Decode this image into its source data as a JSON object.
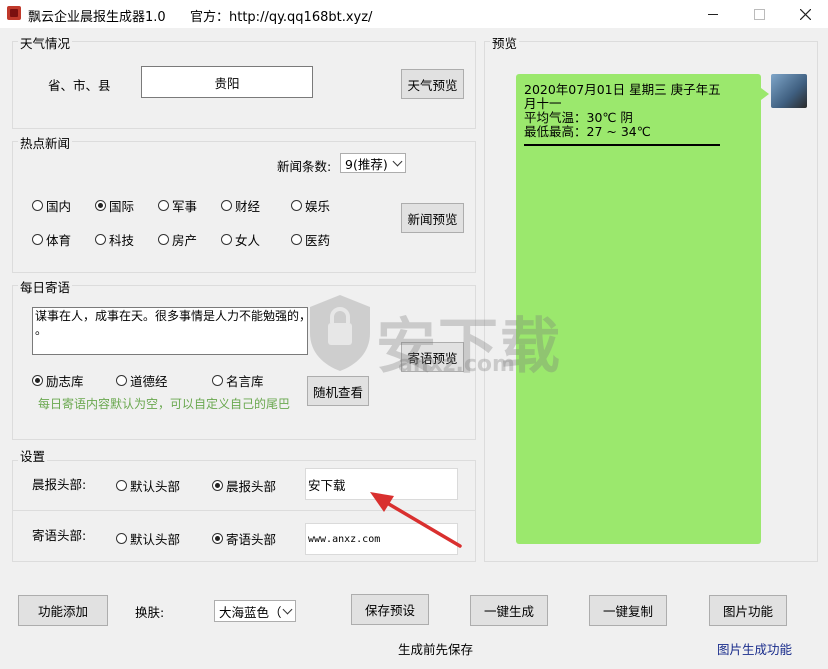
{
  "window": {
    "title": "飘云企业晨报生成器1.0",
    "site": "官方：http://qy.qq168bt.xyz/"
  },
  "weather": {
    "group_label": "天气情况",
    "location_label": "省、市、县",
    "location_value": "贵阳",
    "preview_button": "天气预览"
  },
  "news": {
    "group_label": "热点新闻",
    "count_label": "新闻条数:",
    "count_value": "9(推荐)",
    "preview_button": "新闻预览",
    "categories": [
      {
        "label": "国内",
        "selected": false
      },
      {
        "label": "国际",
        "selected": true
      },
      {
        "label": "军事",
        "selected": false
      },
      {
        "label": "财经",
        "selected": false
      },
      {
        "label": "娱乐",
        "selected": false
      },
      {
        "label": "体育",
        "selected": false
      },
      {
        "label": "科技",
        "selected": false
      },
      {
        "label": "房产",
        "selected": false
      },
      {
        "label": "女人",
        "selected": false
      },
      {
        "label": "医药",
        "selected": false
      }
    ]
  },
  "daily": {
    "group_label": "每日寄语",
    "text_line1": "谋事在人，成事在天。很多事情是人力不能勉强的，随缘就好",
    "text_line2": "。",
    "preview_button": "寄语预览",
    "random_button": "随机查看",
    "sources": [
      {
        "label": "励志库",
        "selected": true
      },
      {
        "label": "道德经",
        "selected": false
      },
      {
        "label": "名言库",
        "selected": false
      }
    ],
    "hint": "每日寄语内容默认为空，可以自定义自己的尾巴",
    "hint_color": "#6aa84f"
  },
  "settings": {
    "group_label": "设置",
    "morning_label": "晨报头部:",
    "morning_opts": [
      {
        "label": "默认头部",
        "selected": false
      },
      {
        "label": "晨报头部",
        "selected": true
      }
    ],
    "morning_value": "安下载",
    "greeting_label": "寄语头部:",
    "greeting_opts": [
      {
        "label": "默认头部",
        "selected": false
      },
      {
        "label": "寄语头部",
        "selected": true
      }
    ],
    "greeting_value": "www.anxz.com"
  },
  "preview": {
    "group_label": "预览",
    "line1": "2020年07月01日   星期三   庚子年五",
    "line2": "月十一",
    "line3": "平均气温：30℃ 阴",
    "line4": "最低最高：27 ~ 34℃",
    "bubble_color": "#9be86d"
  },
  "bottom": {
    "add_button": "功能添加",
    "skin_label": "换肤:",
    "skin_value": "大海蓝色（",
    "save_button": "保存预设",
    "generate_button": "一键生成",
    "copy_button": "一键复制",
    "image_button": "图片功能",
    "save_hint": "生成前先保存",
    "image_link": "图片生成功能",
    "link_color": "#1a2d8c"
  },
  "watermark": {
    "text": "安下载",
    "sub": "anxz.com"
  },
  "icons": {
    "minimize": "minimize-icon",
    "maximize": "maximize-icon",
    "close": "close-icon",
    "arrow": "red-arrow-annotation"
  }
}
